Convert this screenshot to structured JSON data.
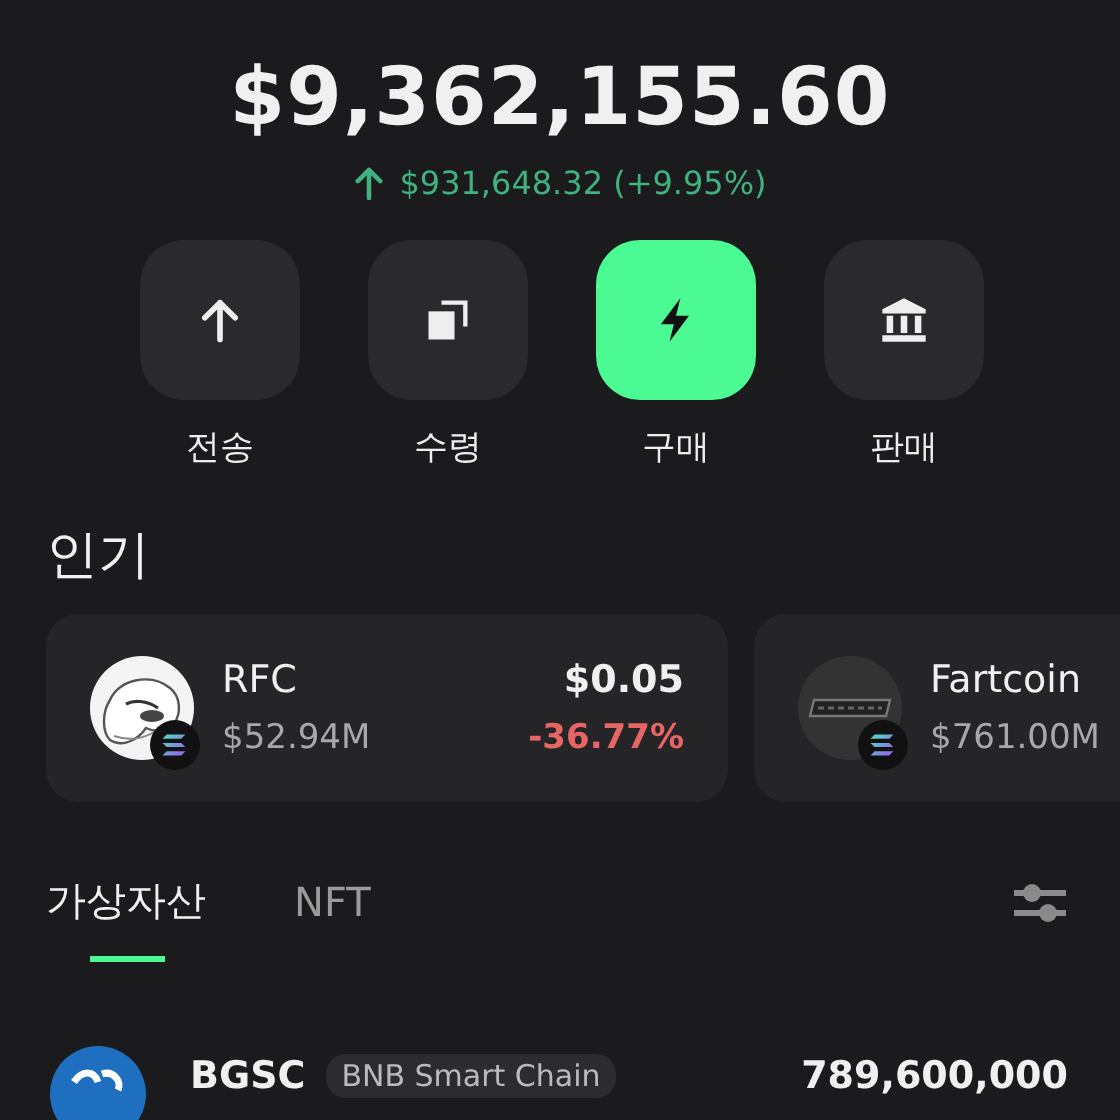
{
  "balance": {
    "total": "$9,362,155.60",
    "change": "$931,648.32 (+9.95%)"
  },
  "actions": [
    {
      "label": "전송",
      "highlighted": false
    },
    {
      "label": "수령",
      "highlighted": false
    },
    {
      "label": "구매",
      "highlighted": true
    },
    {
      "label": "판매",
      "highlighted": false
    }
  ],
  "popular": {
    "title": "인기",
    "cards": [
      {
        "symbol": "RFC",
        "market_cap": "$52.94M",
        "price": "$0.05",
        "change": "-36.77%"
      },
      {
        "symbol": "Fartcoin",
        "market_cap": "$761.00M"
      }
    ]
  },
  "tabs": [
    {
      "label": "가상자산",
      "selected": true
    },
    {
      "label": "NFT",
      "selected": false
    }
  ],
  "assets": [
    {
      "symbol": "BGSC",
      "chain": "BNB Smart Chain",
      "amount": "789,600,000"
    }
  ]
}
